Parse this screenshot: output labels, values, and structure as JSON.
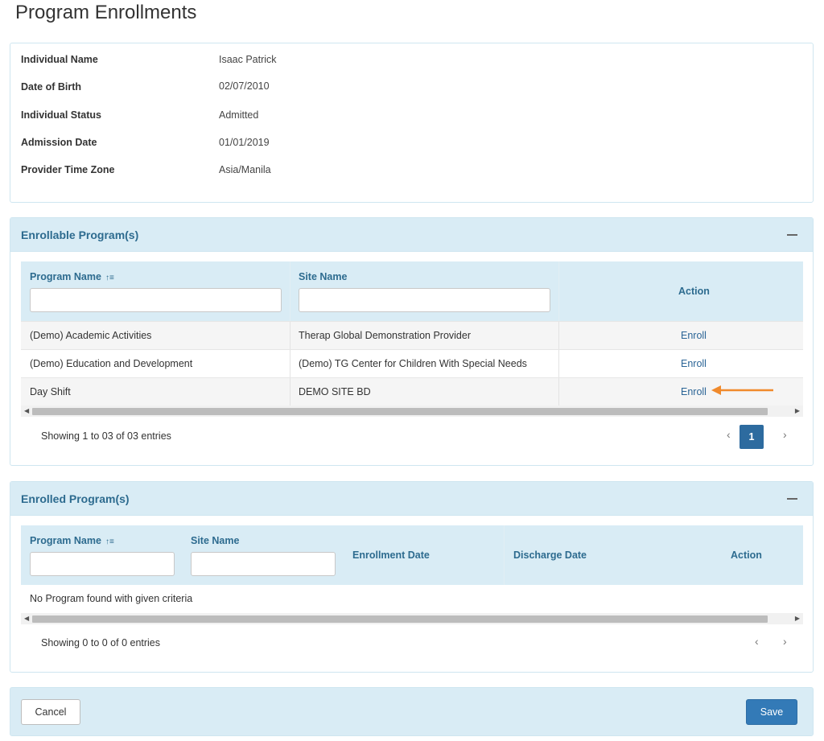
{
  "page_title": "Program Enrollments",
  "individual": [
    {
      "label": "Individual Name",
      "value": "Isaac Patrick"
    },
    {
      "label": "Date of Birth",
      "value": "02/07/2010"
    },
    {
      "label": "Individual Status",
      "value": "Admitted"
    },
    {
      "label": "Admission Date",
      "value": "01/01/2019"
    },
    {
      "label": "Provider Time Zone",
      "value": "Asia/Manila"
    }
  ],
  "enrollable": {
    "title": "Enrollable Program(s)",
    "columns": {
      "program_name": "Program Name",
      "site_name": "Site Name",
      "action": "Action"
    },
    "rows": [
      {
        "program": "(Demo) Academic Activities",
        "site": "Therap Global Demonstration Provider",
        "action": "Enroll"
      },
      {
        "program": "(Demo) Education and Development",
        "site": "(Demo) TG Center for Children With Special Needs",
        "action": "Enroll"
      },
      {
        "program": "Day Shift",
        "site": "DEMO SITE BD",
        "action": "Enroll"
      }
    ],
    "info": "Showing 1 to 03 of 03 entries",
    "current_page": "1"
  },
  "enrolled": {
    "title": "Enrolled Program(s)",
    "columns": {
      "program_name": "Program Name",
      "site_name": "Site Name",
      "enrollment_date": "Enrollment Date",
      "discharge_date": "Discharge Date",
      "action": "Action"
    },
    "empty_message": "No Program found with given criteria",
    "info": "Showing 0 to 0 of 0 entries"
  },
  "footer": {
    "cancel_label": "Cancel",
    "save_label": "Save"
  },
  "colors": {
    "accent": "#337ab7",
    "panel_heading": "#d9ecf5",
    "annotation_arrow": "#f08a2c"
  }
}
